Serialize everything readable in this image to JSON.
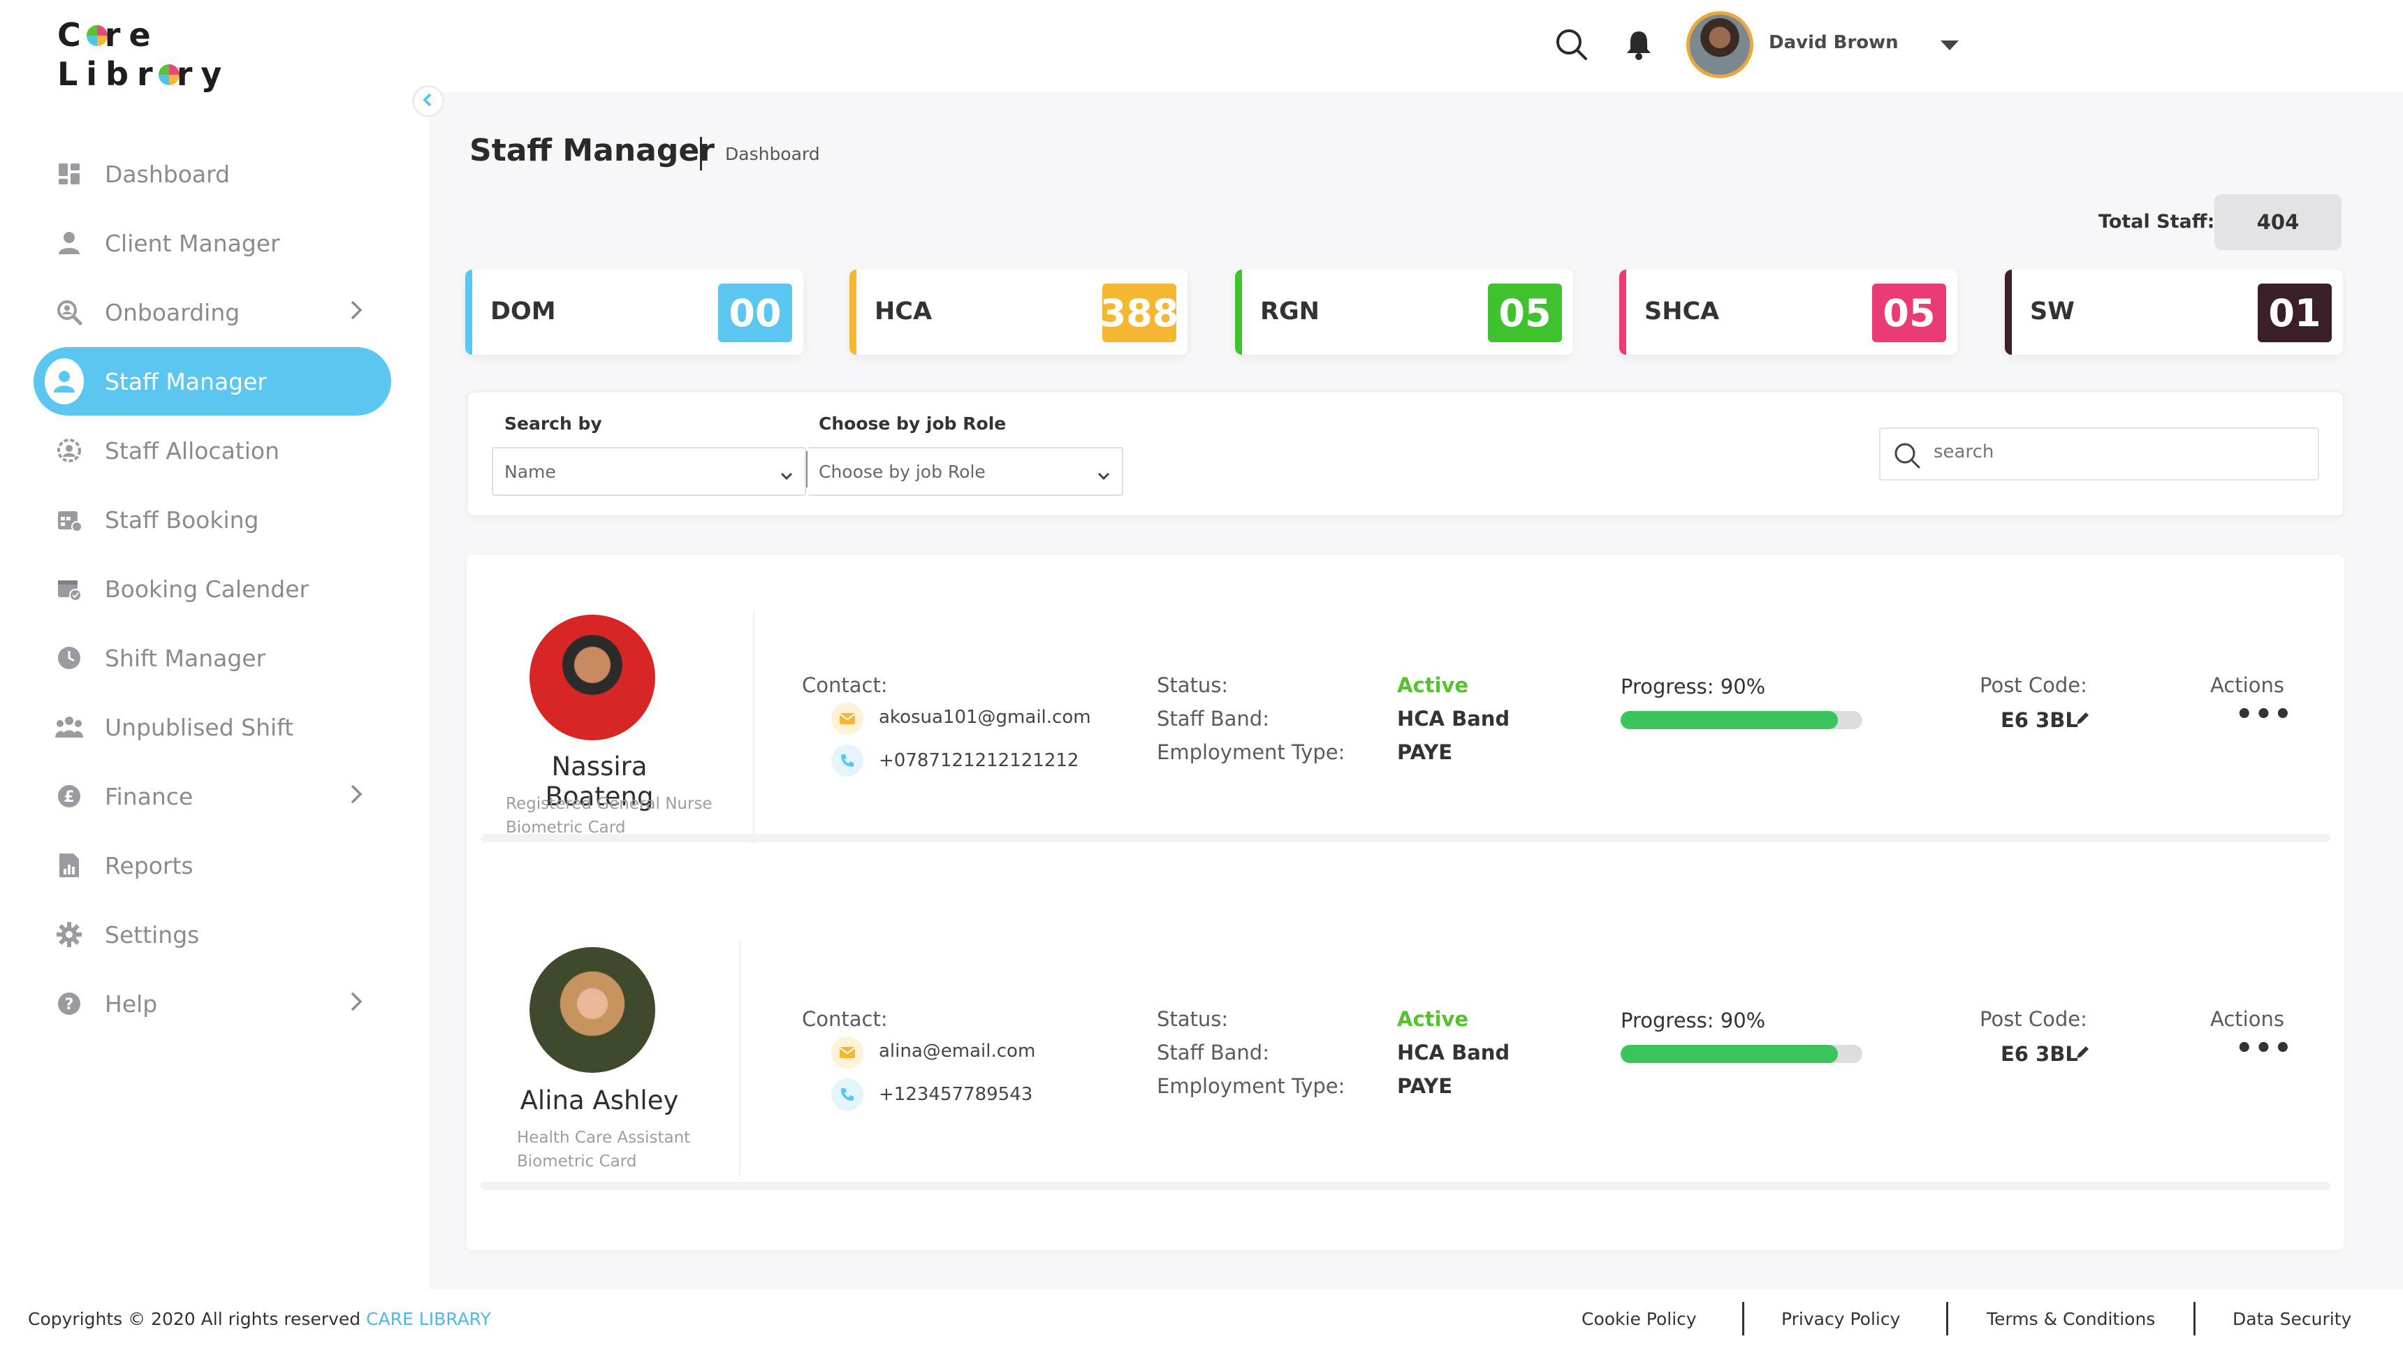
{
  "brand": {
    "line1": "C  re",
    "line2": "Libr  ry"
  },
  "sidebar": {
    "items": [
      {
        "label": "Dashboard",
        "icon": "dashboard-icon",
        "active": false,
        "has_arrow": false
      },
      {
        "label": "Client Manager",
        "icon": "client-icon",
        "active": false,
        "has_arrow": false
      },
      {
        "label": "Onboarding",
        "icon": "onboarding-icon",
        "active": false,
        "has_arrow": true
      },
      {
        "label": "Staff Manager",
        "icon": "staff-icon",
        "active": true,
        "has_arrow": false
      },
      {
        "label": "Staff Allocation",
        "icon": "allocation-icon",
        "active": false,
        "has_arrow": false
      },
      {
        "label": "Staff Booking",
        "icon": "booking-icon",
        "active": false,
        "has_arrow": false
      },
      {
        "label": "Booking Calender",
        "icon": "calendar-icon",
        "active": false,
        "has_arrow": false
      },
      {
        "label": "Shift Manager",
        "icon": "clock-icon",
        "active": false,
        "has_arrow": false
      },
      {
        "label": "Unpublised Shift",
        "icon": "group-icon",
        "active": false,
        "has_arrow": false
      },
      {
        "label": "Finance",
        "icon": "pound-icon",
        "active": false,
        "has_arrow": true
      },
      {
        "label": "Reports",
        "icon": "report-icon",
        "active": false,
        "has_arrow": false
      },
      {
        "label": "Settings",
        "icon": "gear-icon",
        "active": false,
        "has_arrow": false
      },
      {
        "label": "Help",
        "icon": "help-icon",
        "active": false,
        "has_arrow": true
      }
    ]
  },
  "header": {
    "user_name": "David Brown"
  },
  "page": {
    "title": "Staff Manager",
    "breadcrumb": "Dashboard",
    "total_label": "Total Staff:",
    "total_value": "404"
  },
  "roles": [
    {
      "name": "DOM",
      "count": "00",
      "color": "#5bc6ef"
    },
    {
      "name": "HCA",
      "count": "388",
      "color": "#f5b731"
    },
    {
      "name": "RGN",
      "count": "05",
      "color": "#3fc22e"
    },
    {
      "name": "SHCA",
      "count": "05",
      "color": "#ea3b77"
    },
    {
      "name": "SW",
      "count": "01",
      "color": "#3a1f28"
    }
  ],
  "filters": {
    "search_by_label": "Search by",
    "search_by_value": "Name",
    "job_role_label": "Choose by job Role",
    "job_role_value": "Choose by job Role",
    "search_placeholder": "search"
  },
  "labels": {
    "contact": "Contact:",
    "status": "Status:",
    "staff_band": "Staff Band:",
    "employment_type": "Employment Type:",
    "post_code": "Post Code:",
    "actions": "Actions",
    "more": "•••"
  },
  "staff": [
    {
      "name": "Nassira Boateng",
      "role": "Registered General Nurse",
      "card": "Biometric Card",
      "email": "akosua101@gmail.com",
      "phone": "+0787121212121212",
      "status": "Active",
      "band": "HCA Band",
      "employment": "PAYE",
      "progress_label": "Progress: 90%",
      "progress": 0.9,
      "postcode": "E6 3BL"
    },
    {
      "name": "Alina Ashley",
      "role": "Health Care Assistant",
      "card": "Biometric Card",
      "email": "alina@email.com",
      "phone": "+123457789543",
      "status": "Active",
      "band": "HCA Band",
      "employment": "PAYE",
      "progress_label": "Progress: 90%",
      "progress": 0.9,
      "postcode": "E6 3BL"
    }
  ],
  "footer": {
    "copyright": "Copyrights © 2020  All rights reserved ",
    "brand": "CARE LIBRARY",
    "links": [
      "Cookie Policy",
      "Privacy Policy",
      "Terms & Conditions",
      "Data Security"
    ]
  }
}
